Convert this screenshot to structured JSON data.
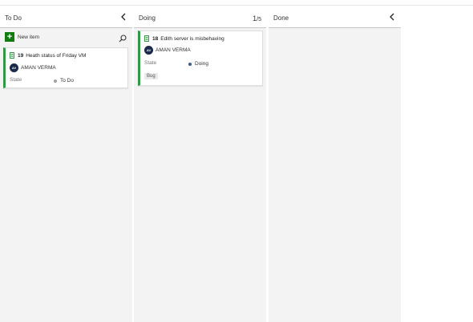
{
  "board": {
    "columns": [
      {
        "title": "To Do",
        "new_item_label": "New item",
        "cards": [
          {
            "id": "19",
            "title": "Heath status of Friday VM",
            "assignee_initials": "AV",
            "assignee_name": "AMAN VERMA",
            "state_label": "State",
            "state_value": "To Do",
            "state_color": "#a0a0a0"
          }
        ]
      },
      {
        "title": "Doing",
        "wip_current": "1",
        "wip_limit": "/5",
        "cards": [
          {
            "id": "18",
            "title": "Edith server is misbehaving",
            "assignee_initials": "AV",
            "assignee_name": "AMAN VERMA",
            "state_label": "State",
            "state_value": "Doing",
            "state_color": "#3a5d8f",
            "tag": "Bug"
          }
        ]
      },
      {
        "title": "Done"
      }
    ]
  },
  "colors": {
    "card_accent": "#339947",
    "new_item_green": "#107c10",
    "avatar_bg": "#1b2a4a",
    "column_bg": "#f3f3f3"
  },
  "icons": {
    "collapse": "chevron-left-icon",
    "search": "search-icon",
    "work_item": "task-icon",
    "add": "plus-icon"
  }
}
